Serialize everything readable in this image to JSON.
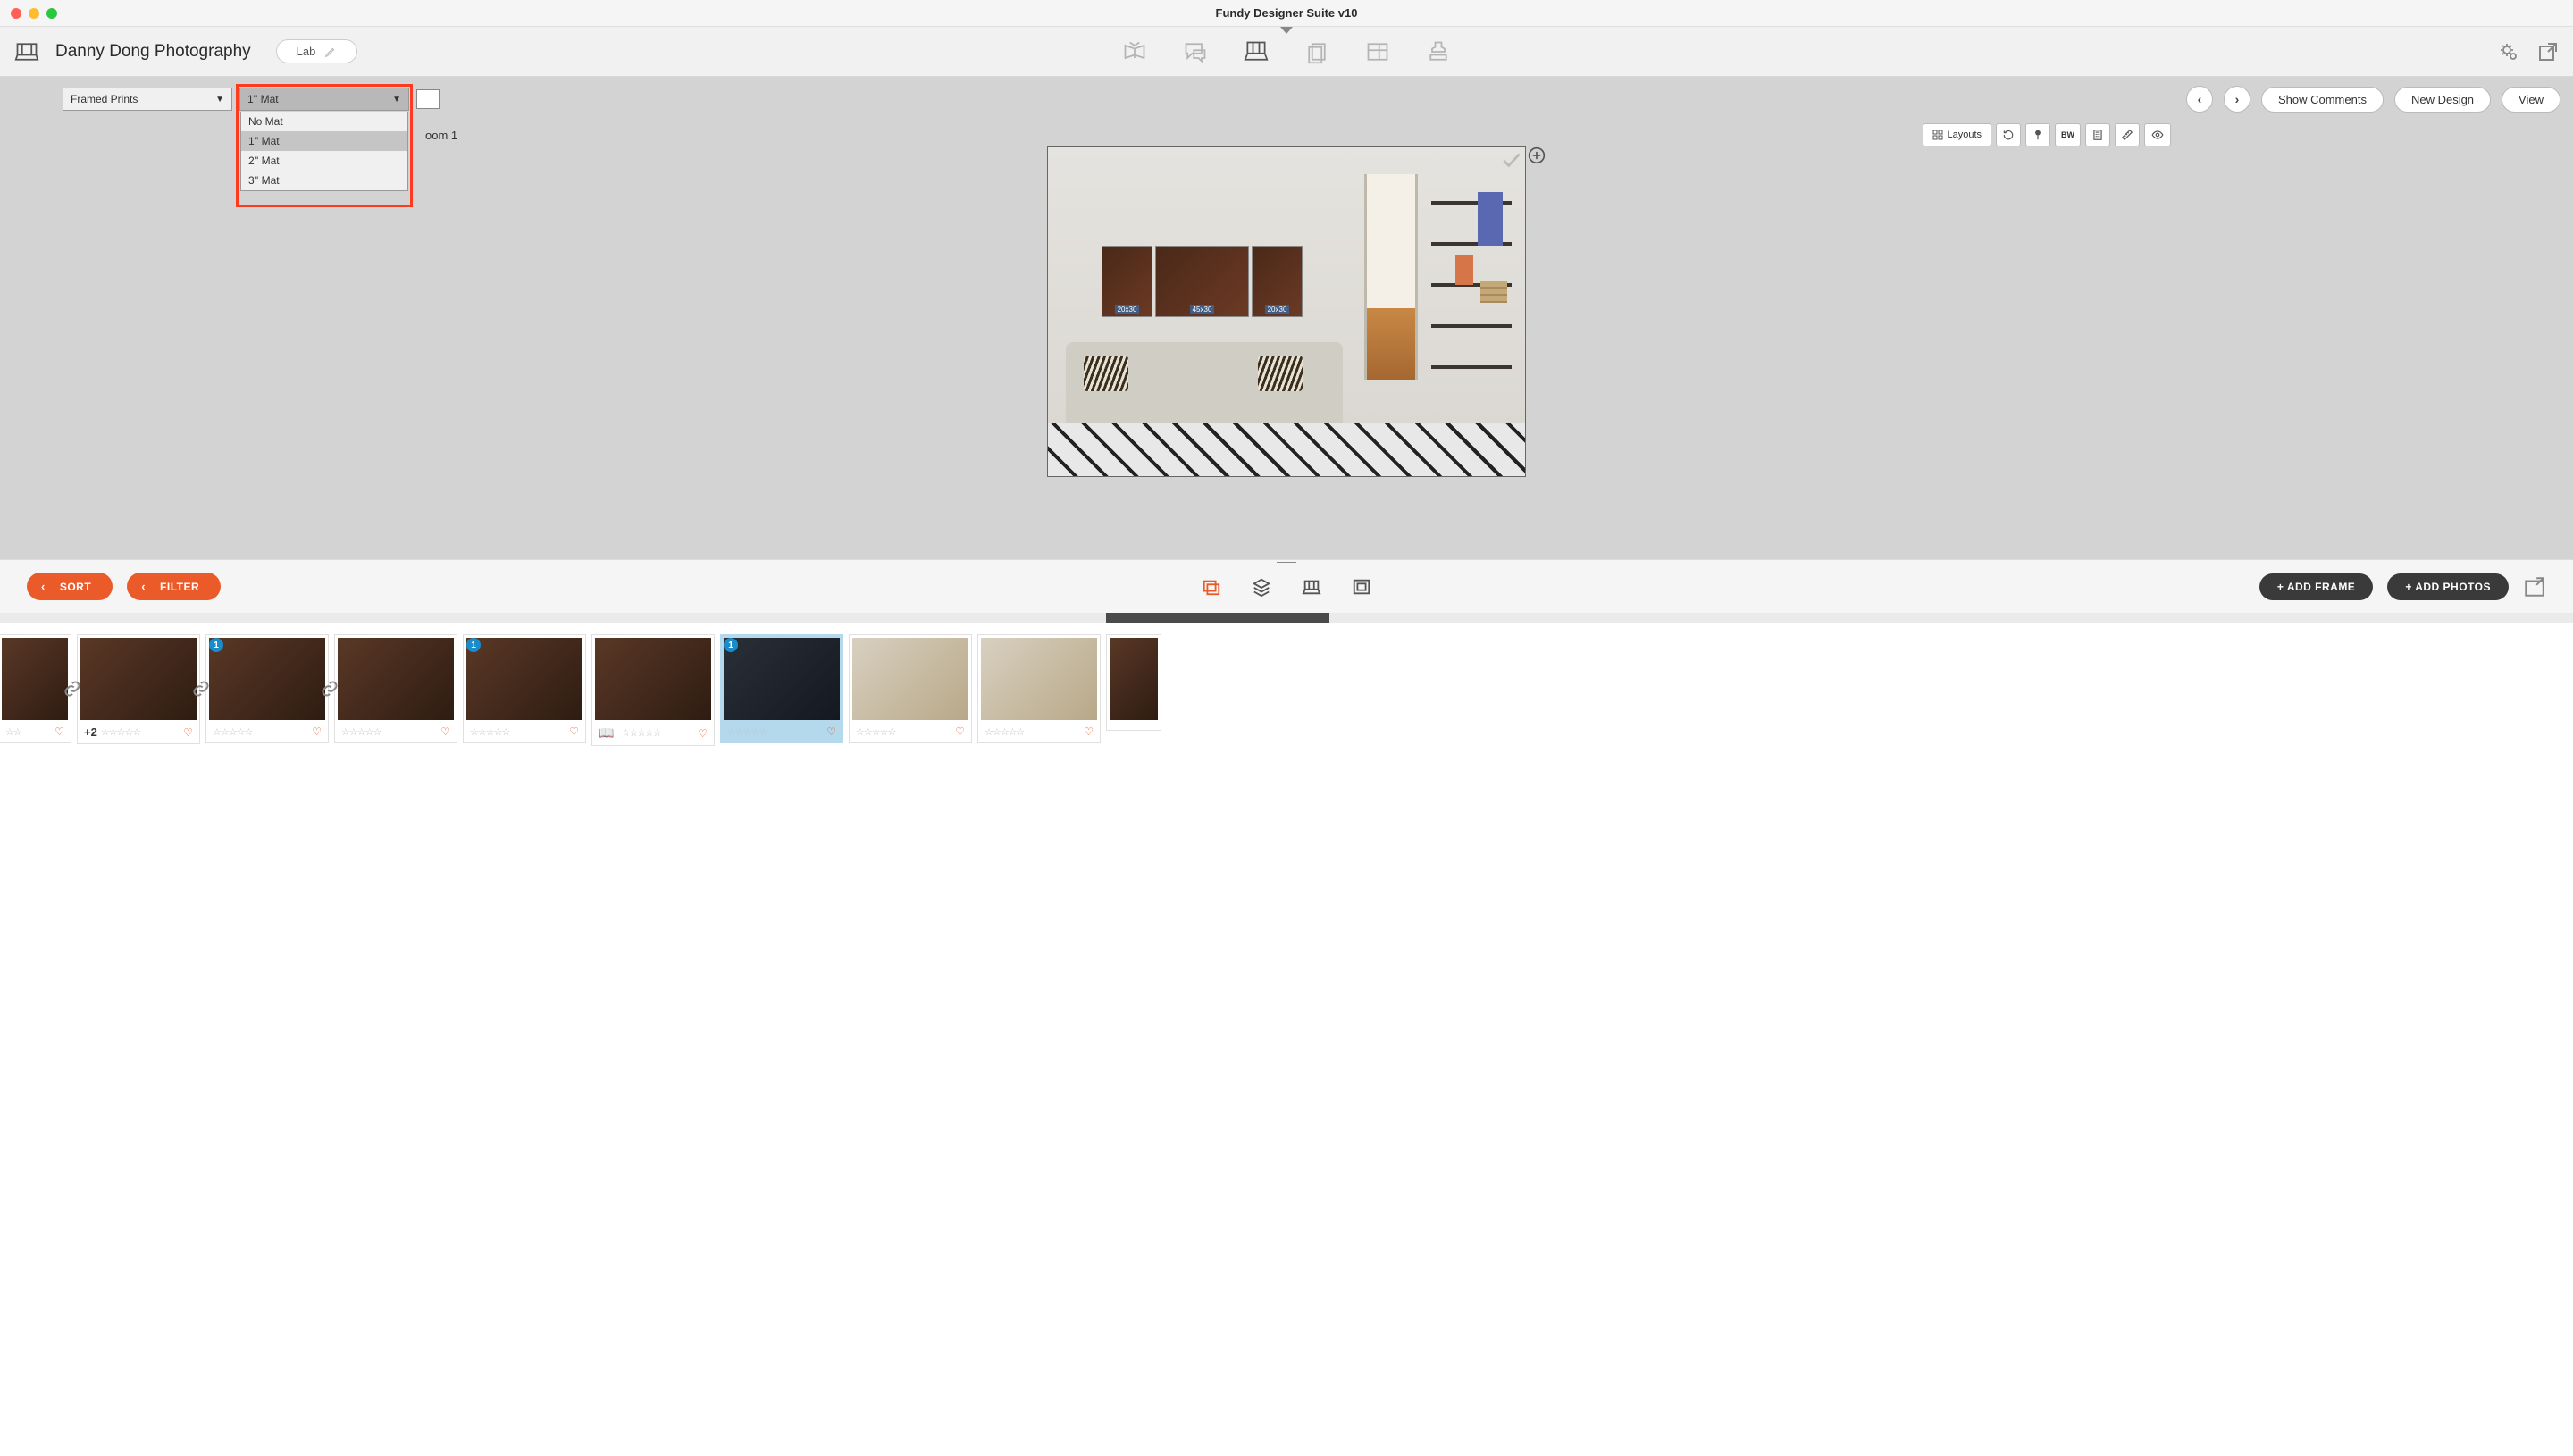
{
  "window": {
    "title": "Fundy Designer Suite v10"
  },
  "project": {
    "studio_name": "Danny Dong Photography",
    "lab_label": "Lab"
  },
  "dropdowns": {
    "print_type": {
      "selected": "Framed Prints"
    },
    "mat": {
      "selected": "1'' Mat",
      "options": [
        "No Mat",
        "1'' Mat",
        "2'' Mat",
        "3'' Mat"
      ],
      "highlighted_index": 1
    }
  },
  "sec_buttons": {
    "show_comments": "Show Comments",
    "new_design": "New Design",
    "view": "View"
  },
  "canvas": {
    "room_label": "oom 1",
    "layouts_label": "Layouts",
    "bw_label": "BW",
    "prints": [
      {
        "size": "20x30"
      },
      {
        "size": "45x30"
      },
      {
        "size": "20x30"
      }
    ]
  },
  "bottom": {
    "sort_label": "SORT",
    "filter_label": "FILTER",
    "add_frame_label": "+ ADD FRAME",
    "add_photos_label": "+ ADD PHOTOS"
  },
  "thumbs": [
    {
      "variant": "first",
      "stars": "☆☆",
      "heart": true
    },
    {
      "plus": "+2",
      "stars": "☆☆☆☆☆",
      "heart": true,
      "link_before": true
    },
    {
      "badge": "1",
      "stars": "☆☆☆☆☆",
      "heart": true,
      "link_before": true
    },
    {
      "stars": "☆☆☆☆☆",
      "heart": true,
      "link_before": true
    },
    {
      "badge": "1",
      "stars": "☆☆☆☆☆",
      "heart": true
    },
    {
      "book": true,
      "stars": "☆☆☆☆☆",
      "heart": true
    },
    {
      "badge": "1",
      "highlighted": true,
      "dark": true,
      "stars": "☆☆☆☆☆",
      "heart": true
    },
    {
      "light": true,
      "stars": "☆☆☆☆☆",
      "heart": true
    },
    {
      "light": true,
      "stars": "☆☆☆☆☆",
      "heart": true
    },
    {
      "variant": "last",
      "stars": "",
      "heart": false
    }
  ]
}
